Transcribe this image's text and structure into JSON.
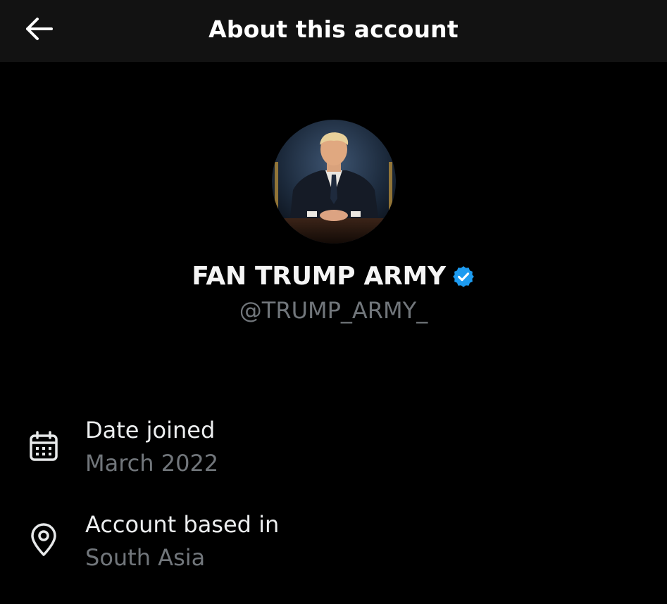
{
  "header": {
    "title": "About this account",
    "back_icon": "arrow-left-icon"
  },
  "profile": {
    "display_name": "FAN TRUMP ARMY",
    "handle": "@TRUMP_ARMY_",
    "verified": true,
    "verified_icon": "verified-badge-icon",
    "verified_color": "#1d9bf0"
  },
  "info": [
    {
      "icon": "calendar-icon",
      "label": "Date joined",
      "value": "March 2022"
    },
    {
      "icon": "location-pin-icon",
      "label": "Account based in",
      "value": "South Asia"
    }
  ],
  "colors": {
    "background": "#000000",
    "header_background": "#121212",
    "primary_text": "#e7e9ea",
    "secondary_text": "#71767b"
  }
}
